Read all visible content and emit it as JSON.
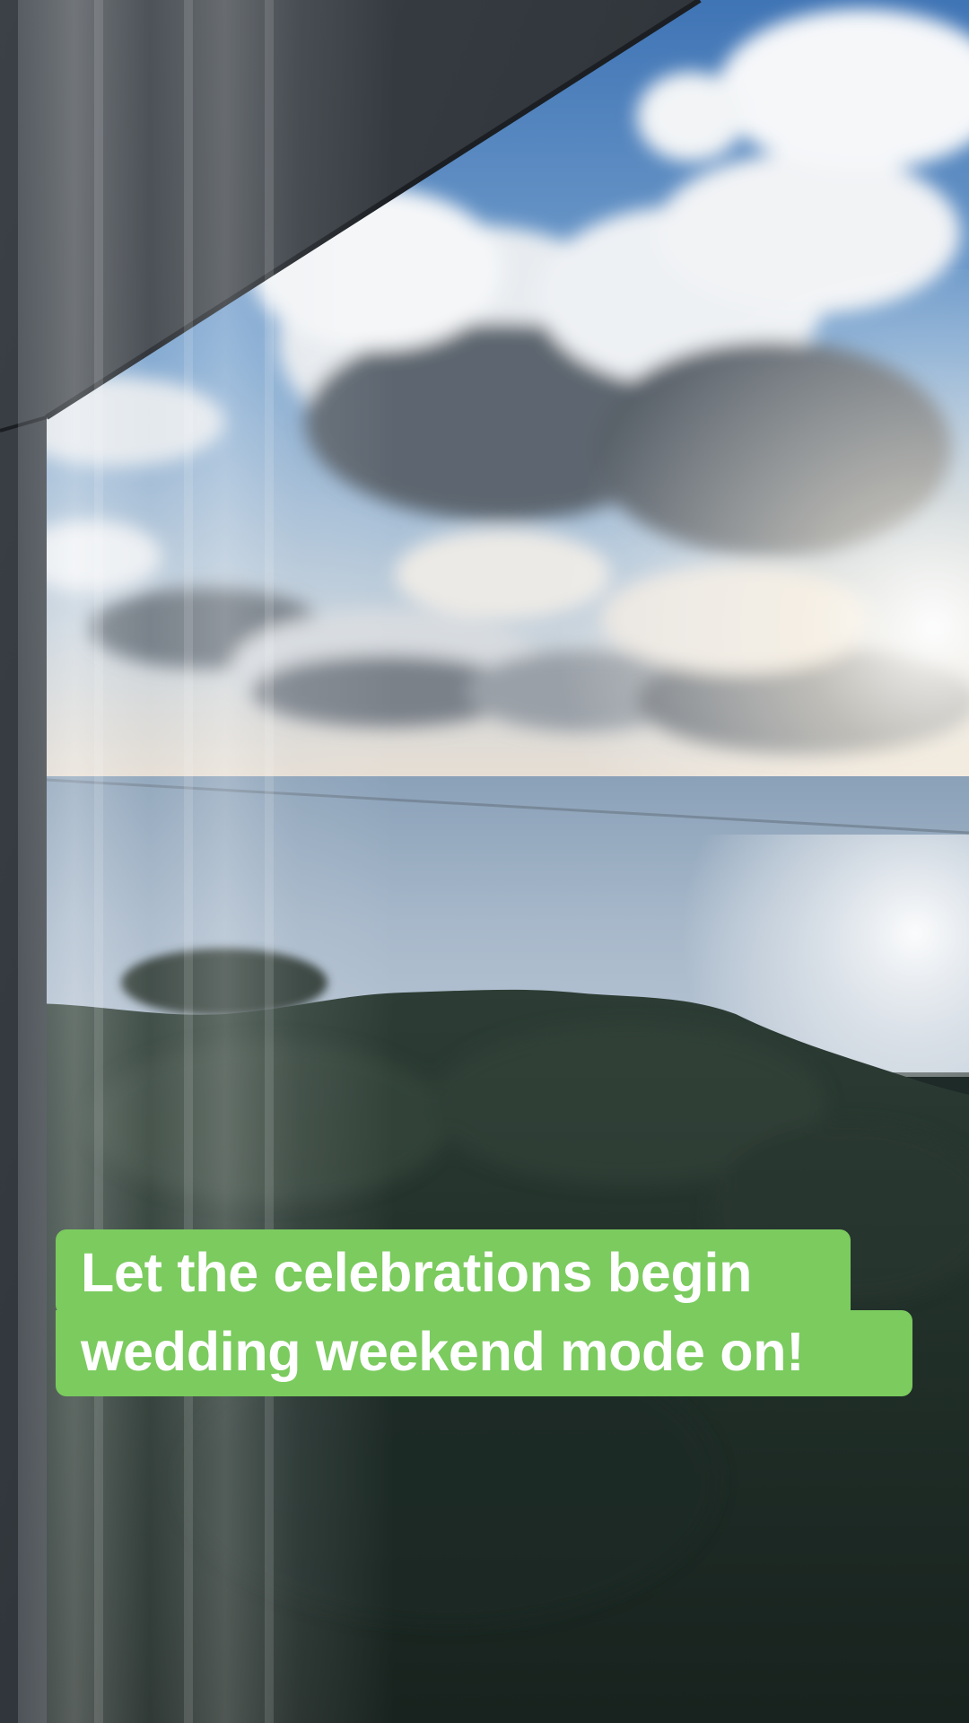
{
  "caption": {
    "line1": "Let the celebrations begin",
    "line2": "wedding weekend mode on!"
  },
  "colors": {
    "caption_bg": "#7bcb5e",
    "caption_text": "#ffffff",
    "sky": "#6f9dcc",
    "sea": "#a9bcd0",
    "trees": "#22302a"
  }
}
